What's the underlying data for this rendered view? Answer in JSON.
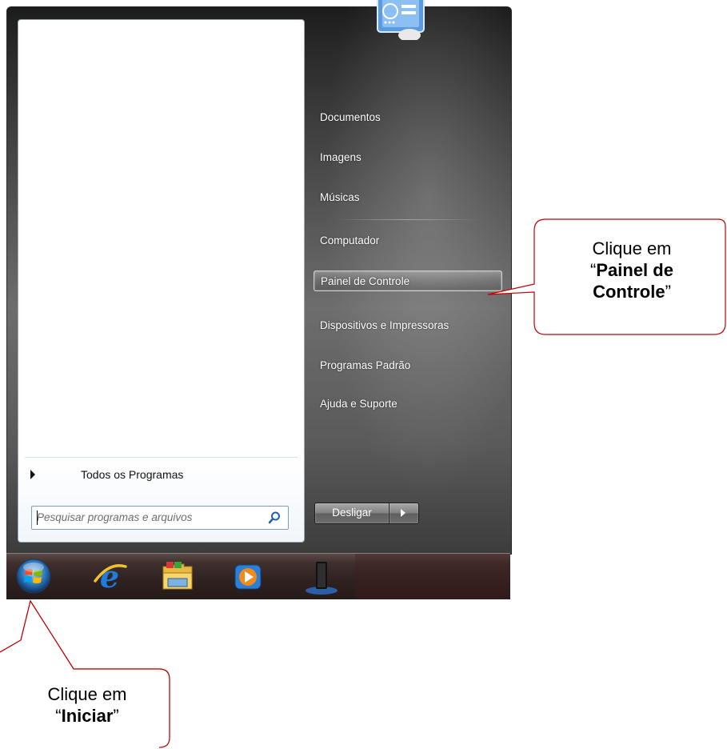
{
  "start_menu": {
    "all_programs_label": "Todos os Programas",
    "search_placeholder": "Pesquisar programas e arquivos",
    "right_items": [
      {
        "label": "Documentos"
      },
      {
        "label": "Imagens"
      },
      {
        "label": "Músicas"
      },
      {
        "label": "Computador"
      },
      {
        "label": "Painel de Controle",
        "highlighted": true
      },
      {
        "label": "Dispositivos e Impressoras"
      },
      {
        "label": "Programas Padrão"
      },
      {
        "label": "Ajuda e Suporte"
      }
    ],
    "shutdown_label": "Desligar"
  },
  "taskbar": {
    "icons": [
      "windows-start-orb-icon",
      "internet-explorer-icon",
      "windows-explorer-folder-icon",
      "media-player-icon",
      "device-icon"
    ]
  },
  "callouts": {
    "painel": {
      "line1": "Clique em",
      "line2_pre": "“",
      "line2_bold": "Painel de",
      "line3_bold": "Controle",
      "line3_post": "”"
    },
    "iniciar": {
      "line1": "Clique em",
      "line2_pre": "“",
      "line2_bold": "Iniciar",
      "line2_post": "”"
    }
  },
  "colors": {
    "callout_border": "#c00000",
    "highlight_border": "#e6e6e6"
  }
}
